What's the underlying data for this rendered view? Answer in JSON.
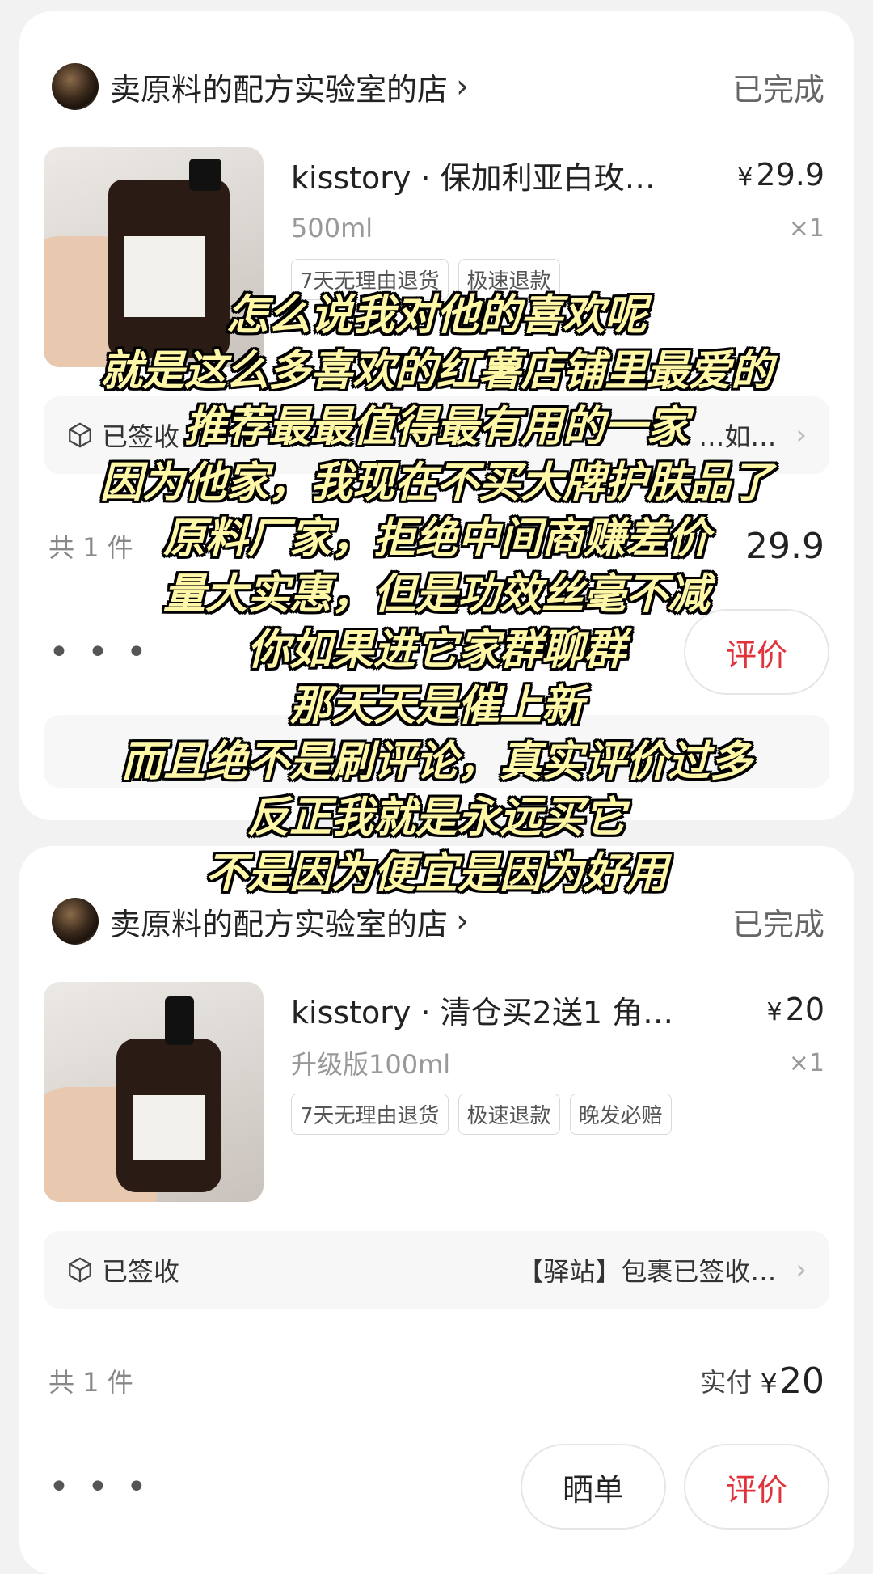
{
  "orders": [
    {
      "shop_name": "卖原料的配方实验室的店",
      "status": "已完成",
      "product_title": "kisstory · 保加利亚白玫…",
      "price_symbol": "¥",
      "price": "29.9",
      "spec": "500ml",
      "qty": "×1",
      "tags": [
        "7天无理由退货",
        "极速退款"
      ],
      "logistics_status": "已签收",
      "logistics_detail": "…如…",
      "count": "共 1 件",
      "paid_amount": "29.9",
      "btn_review": "评价"
    },
    {
      "shop_name": "卖原料的配方实验室的店",
      "status": "已完成",
      "product_title": "kisstory · 清仓买2送1 角…",
      "price_symbol": "¥",
      "price": "20",
      "spec": "升级版100ml",
      "qty": "×1",
      "tags": [
        "7天无理由退货",
        "极速退款",
        "晚发必赔"
      ],
      "logistics_status": "已签收",
      "logistics_detail": "【驿站】包裹已签收…",
      "count": "共 1 件",
      "paid_label": "实付",
      "paid_symbol": "¥",
      "paid_amount": "20",
      "btn_show": "晒单",
      "btn_review": "评价"
    }
  ],
  "more_label": "• • •",
  "overlay_lines": [
    "怎么说我对他的喜欢呢",
    "就是这么多喜欢的红薯店铺里最爱的",
    "推荐最最值得最有用的一家",
    "因为他家，我现在不买大牌护肤品了",
    "原料厂家，拒绝中间商赚差价",
    "量大实惠，但是功效丝毫不减",
    "你如果进它家群聊群",
    "那天天是催上新",
    "而且绝不是刷评论，真实评价过多",
    "反正我就是永远买它",
    "不是因为便宜是因为好用"
  ],
  "colors": {
    "accent_red": "#e0343c",
    "overlay_text": "#fff7a8",
    "page_bg": "#f2f2f2"
  }
}
